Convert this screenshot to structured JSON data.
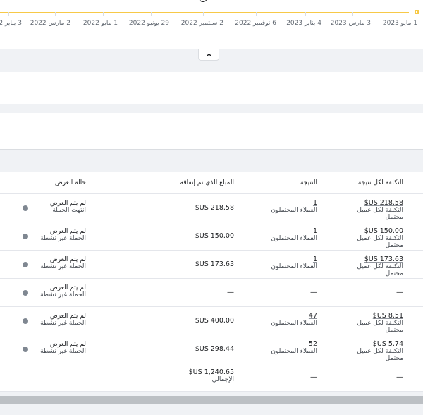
{
  "chart": {
    "dates": [
      "1 مايو 2023",
      "3 مارس 2023",
      "4 يناير 2023",
      "6 نوفمبر 2022",
      "2 سبتمبر 2022",
      "29 يونيو 2022",
      "1 مايو 2022",
      "2 مارس 2022",
      "3 يناير 2"
    ],
    "line_color": "#f7c948"
  },
  "table": {
    "headers": {
      "cost_per_result": "التكلفة لكل نتيجة",
      "results": "النتيجة",
      "amount_spent": "المبلغ الذي تم إنفاقه",
      "delivery": "حالة العرض"
    },
    "rows": [
      {
        "cost": "218.58 US$",
        "cost_sub": "التكلفة لكل عميل محتمل",
        "result": "1",
        "result_sub": "العملاء المحتملون",
        "spent": "218.58 US$",
        "status": "لم يتم العرض",
        "status_sub": "انتهت الحملة"
      },
      {
        "cost": "150.00 US$",
        "cost_sub": "التكلفة لكل عميل محتمل",
        "result": "1",
        "result_sub": "العملاء المحتملون",
        "spent": "150.00 US$",
        "status": "لم يتم العرض",
        "status_sub": "الحملة غير نشطة"
      },
      {
        "cost": "173.63 US$",
        "cost_sub": "التكلفة لكل عميل محتمل",
        "result": "1",
        "result_sub": "العملاء المحتملون",
        "spent": "173.63 US$",
        "status": "لم يتم العرض",
        "status_sub": "الحملة غير نشطة"
      },
      {
        "cost": "—",
        "cost_sub": "",
        "result": "—",
        "result_sub": "",
        "spent": "—",
        "status": "لم يتم العرض",
        "status_sub": "الحملة غير نشطة"
      },
      {
        "cost": "8.51 US$",
        "cost_sub": "التكلفة لكل عميل محتمل",
        "result": "47",
        "result_sub": "العملاء المحتملون",
        "spent": "400.00 US$",
        "status": "لم يتم العرض",
        "status_sub": "الحملة غير نشطة"
      },
      {
        "cost": "5.74 US$",
        "cost_sub": "التكلفة لكل عميل محتمل",
        "result": "52",
        "result_sub": "العملاء المحتملون",
        "spent": "298.44 US$",
        "status": "لم يتم العرض",
        "status_sub": "الحملة غير نشطة"
      }
    ],
    "total": {
      "cost": "—",
      "result": "—",
      "spent": "1,240.65 US$",
      "spent_sub": "الإجمالي"
    }
  },
  "colors": {
    "status_dot": "#7f8791",
    "accent": "#f7c948"
  }
}
